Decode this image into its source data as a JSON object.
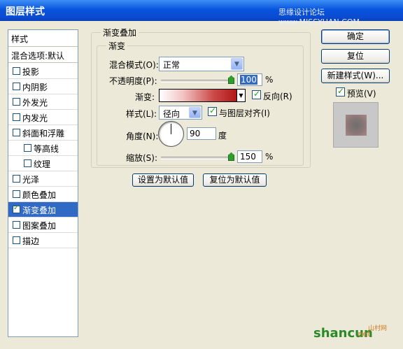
{
  "window": {
    "title": "图层样式",
    "watermark": "思缘设计论坛 www.MISSYUAN.COM"
  },
  "styles_panel": {
    "header": "样式",
    "blend_options": "混合选项:默认",
    "items": [
      {
        "label": "投影",
        "checked": false,
        "indent": false,
        "selected": false
      },
      {
        "label": "内阴影",
        "checked": false,
        "indent": false,
        "selected": false
      },
      {
        "label": "外发光",
        "checked": false,
        "indent": false,
        "selected": false
      },
      {
        "label": "内发光",
        "checked": false,
        "indent": false,
        "selected": false
      },
      {
        "label": "斜面和浮雕",
        "checked": false,
        "indent": false,
        "selected": false
      },
      {
        "label": "等高线",
        "checked": false,
        "indent": true,
        "selected": false
      },
      {
        "label": "纹理",
        "checked": false,
        "indent": true,
        "selected": false
      },
      {
        "label": "光泽",
        "checked": false,
        "indent": false,
        "selected": false
      },
      {
        "label": "颜色叠加",
        "checked": false,
        "indent": false,
        "selected": false
      },
      {
        "label": "渐变叠加",
        "checked": true,
        "indent": false,
        "selected": true
      },
      {
        "label": "图案叠加",
        "checked": false,
        "indent": false,
        "selected": false
      },
      {
        "label": "描边",
        "checked": false,
        "indent": false,
        "selected": false
      }
    ]
  },
  "gradient_overlay": {
    "outer_title": "渐变叠加",
    "inner_title": "渐变",
    "blend_mode_label": "混合模式(O):",
    "blend_mode_value": "正常",
    "opacity_label": "不透明度(P):",
    "opacity_value": "100",
    "opacity_percent": 100,
    "percent_sign": "%",
    "gradient_label": "渐变:",
    "reverse_label": "反向(R)",
    "reverse_checked": true,
    "style_label": "样式(L):",
    "style_value": "径向",
    "align_label": "与图层对齐(I)",
    "align_checked": true,
    "angle_label": "角度(N):",
    "angle_value": "90",
    "angle_unit": "度",
    "scale_label": "缩放(S):",
    "scale_value": "150",
    "scale_percent": 150,
    "set_default_button": "设置为默认值",
    "reset_default_button": "复位为默认值"
  },
  "actions": {
    "ok": "确定",
    "reset": "复位",
    "new_style": "新建样式(W)...",
    "preview_label": "预览(V)",
    "preview_checked": true
  },
  "branding": {
    "brand": "shancun",
    "brand_sub": ".net",
    "tag": "山村网"
  },
  "colors": {
    "titlebar": "#0a4ad0",
    "selection": "#316ac5",
    "gradient_start": "#ffffff",
    "gradient_end": "#b01818"
  }
}
